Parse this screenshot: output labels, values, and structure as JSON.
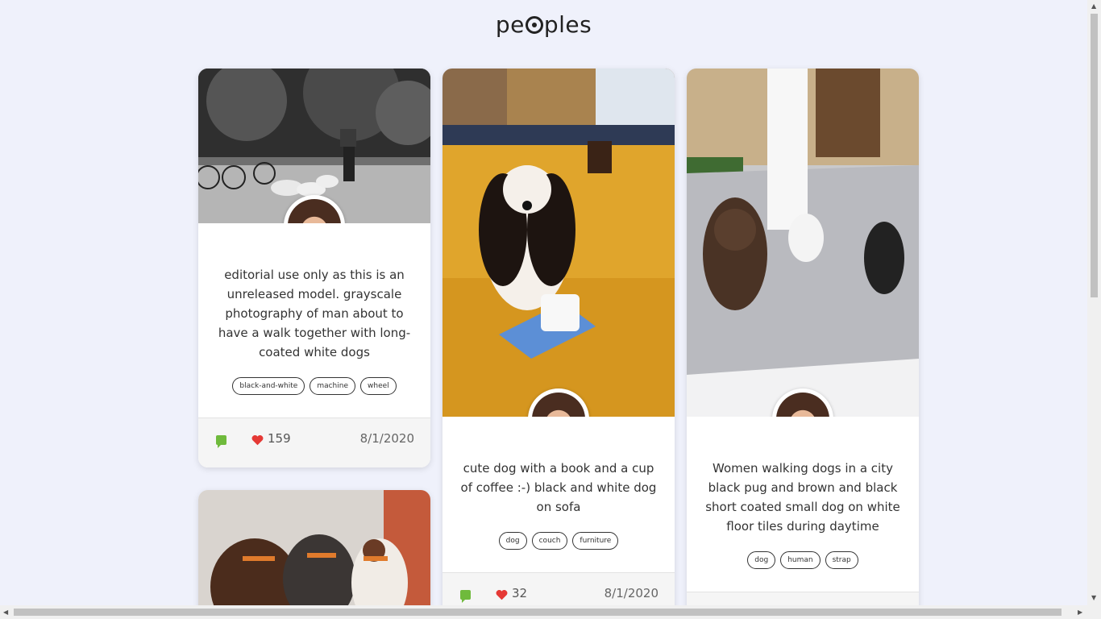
{
  "logo": {
    "prefix": "pe",
    "suffix": "ples"
  },
  "cards": [
    {
      "description": "editorial use only as this is an unreleased model. grayscale photography of man about to have a walk together with long-coated white dogs",
      "tags": [
        "black-and-white",
        "machine",
        "wheel"
      ],
      "likes": "159",
      "date": "8/1/2020"
    },
    {
      "description": "cute dog with a book and a cup of coffee :-) black and white dog on sofa",
      "tags": [
        "dog",
        "couch",
        "furniture"
      ],
      "likes": "32",
      "date": "8/1/2020"
    },
    {
      "description": "Women walking dogs in a city black pug and brown and black short coated small dog on white floor tiles during daytime",
      "tags": [
        "dog",
        "human",
        "strap"
      ]
    }
  ],
  "colors": {
    "background": "#eff1fb",
    "comment": "#6fba3c",
    "heart": "#e53935"
  }
}
